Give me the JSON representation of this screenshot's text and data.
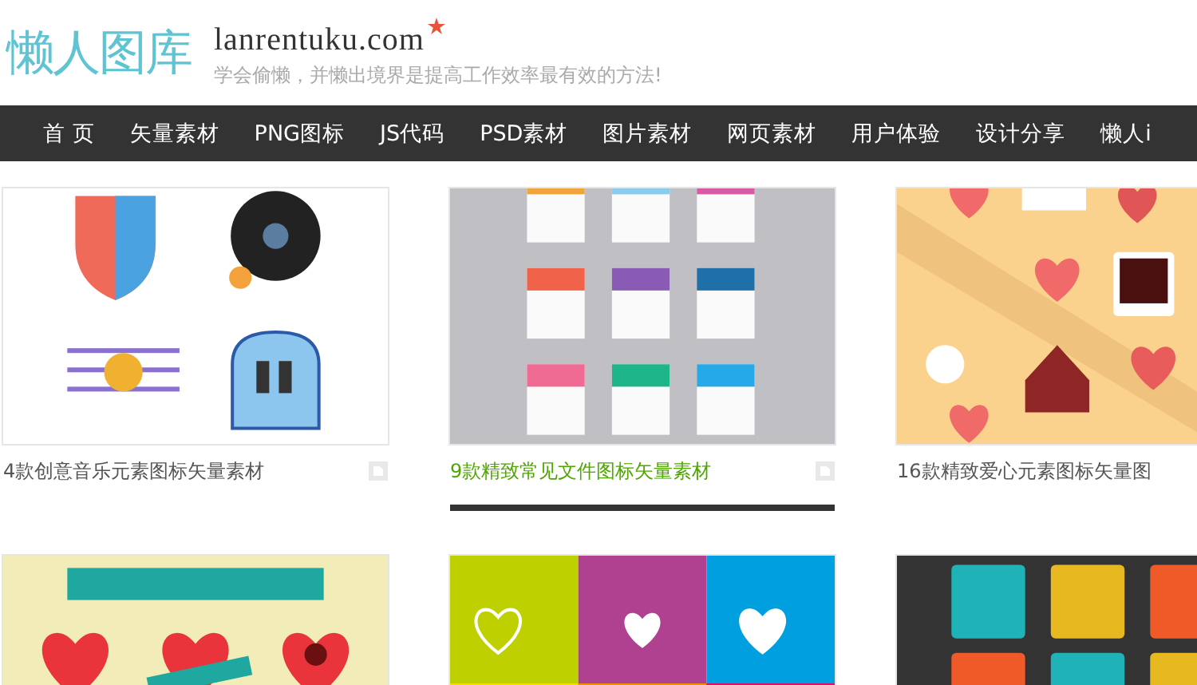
{
  "header": {
    "logo": "懒人图库",
    "domain": "lanrentuku.com",
    "tagline": "学会偷懒，并懒出境界是提高工作效率最有效的方法!"
  },
  "nav": [
    {
      "label": "首 页",
      "selected": false
    },
    {
      "label": "矢量素材",
      "selected": false
    },
    {
      "label": "PNG图标",
      "selected": false
    },
    {
      "label": "JS代码",
      "selected": false
    },
    {
      "label": "PSD素材",
      "selected": false
    },
    {
      "label": "图片素材",
      "selected": false
    },
    {
      "label": "网页素材",
      "selected": false
    },
    {
      "label": "用户体验",
      "selected": false
    },
    {
      "label": "设计分享",
      "selected": false
    },
    {
      "label": "懒人i",
      "selected": false
    }
  ],
  "cards": [
    {
      "kind": "picture",
      "title": "4款创意音乐元素图标矢量素材",
      "selected": false,
      "icon": true
    },
    {
      "kind": "picture",
      "title": "9款精致常见文件图标矢量素材",
      "selected": true,
      "icon": true
    },
    {
      "kind": "picture",
      "title": "16款精致爱心元素图标矢量图",
      "selected": false
    },
    {
      "kind": "picture"
    },
    {
      "kind": "picture"
    },
    {
      "kind": "picture"
    }
  ]
}
